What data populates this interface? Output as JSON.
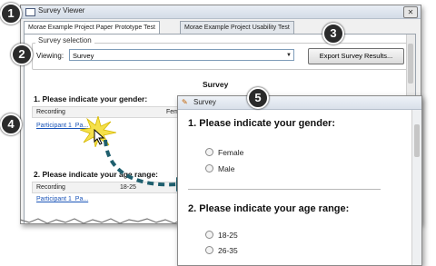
{
  "window": {
    "title": "Survey Viewer",
    "close_glyph": "✕"
  },
  "tabs": [
    {
      "label": "Morae Example Project Paper Prototype Test",
      "active": true
    },
    {
      "label": "Morae Example Project Usability Test",
      "active": false
    }
  ],
  "survey_selection": {
    "legend": "Survey selection",
    "viewing_label": "Viewing:",
    "viewing_value": "Survey",
    "export_button": "Export Survey Results..."
  },
  "survey_heading": "Survey",
  "questions": [
    {
      "text": "1. Please indicate your gender:",
      "columns": [
        "Recording",
        "Female"
      ],
      "rows": [
        {
          "recording": "Participant 1_Pa...",
          "value": ""
        }
      ]
    },
    {
      "text": "2. Please indicate your age range:",
      "columns": [
        "Recording",
        "18-25"
      ],
      "rows": [
        {
          "recording": "Participant 1_Pa...",
          "value": ""
        }
      ]
    }
  ],
  "popup": {
    "title": "Survey",
    "questions": [
      {
        "text": "1. Please indicate your gender:",
        "options": [
          "Female",
          "Male"
        ]
      },
      {
        "text": "2. Please indicate your age range:",
        "options": [
          "18-25",
          "26-35"
        ]
      }
    ]
  },
  "callouts": [
    "1",
    "2",
    "3",
    "4",
    "5"
  ],
  "colors": {
    "link": "#1a54b8",
    "arrow": "#1f5f6e",
    "badge": "#2b2b2b",
    "star": "#f5e04a"
  }
}
